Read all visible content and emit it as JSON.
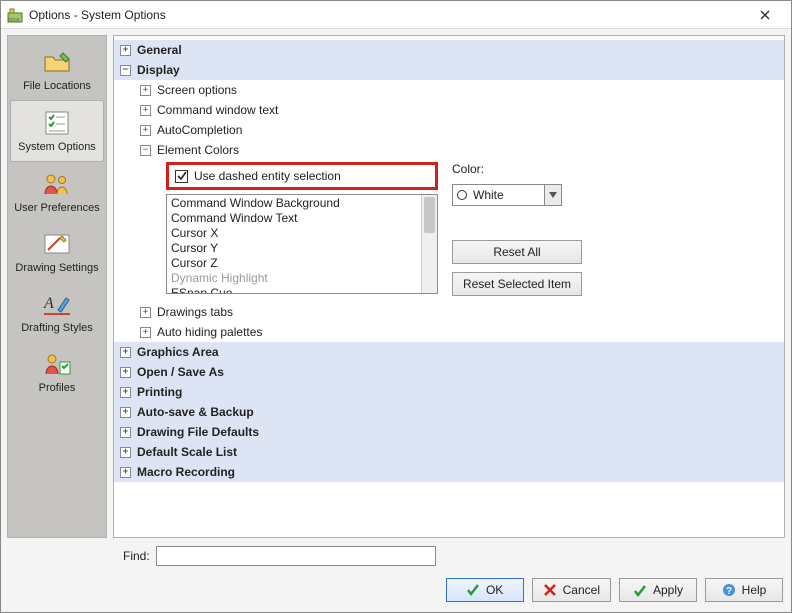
{
  "window": {
    "title": "Options - System Options"
  },
  "sidebar": {
    "items": [
      {
        "label": "File Locations"
      },
      {
        "label": "System Options",
        "selected": true
      },
      {
        "label": "User Preferences"
      },
      {
        "label": "Drawing Settings"
      },
      {
        "label": "Drafting Styles"
      },
      {
        "label": "Profiles"
      }
    ]
  },
  "tree": {
    "general": "General",
    "display": "Display",
    "screen_options": "Screen options",
    "command_window_text": "Command window text",
    "autocompletion": "AutoCompletion",
    "element_colors": "Element Colors",
    "drawings_tabs": "Drawings tabs",
    "auto_hiding": "Auto hiding palettes",
    "graphics_area": "Graphics Area",
    "open_save": "Open / Save As",
    "printing": "Printing",
    "autosave": "Auto-save & Backup",
    "drawing_defaults": "Drawing File Defaults",
    "scale_list": "Default Scale List",
    "macro": "Macro Recording"
  },
  "element_colors": {
    "checkbox_label": "Use dashed entity selection",
    "checkbox_checked": true,
    "list": [
      {
        "label": "Command Window Background"
      },
      {
        "label": "Command Window Text"
      },
      {
        "label": "Cursor X"
      },
      {
        "label": "Cursor Y"
      },
      {
        "label": "Cursor Z"
      },
      {
        "label": "Dynamic Highlight",
        "disabled": true
      },
      {
        "label": "ESnap Cue"
      }
    ],
    "color_label": "Color:",
    "color_value": "White",
    "reset_all": "Reset All",
    "reset_selected": "Reset Selected Item"
  },
  "find": {
    "label": "Find:",
    "value": ""
  },
  "buttons": {
    "ok": "OK",
    "cancel": "Cancel",
    "apply": "Apply",
    "help": "Help"
  }
}
